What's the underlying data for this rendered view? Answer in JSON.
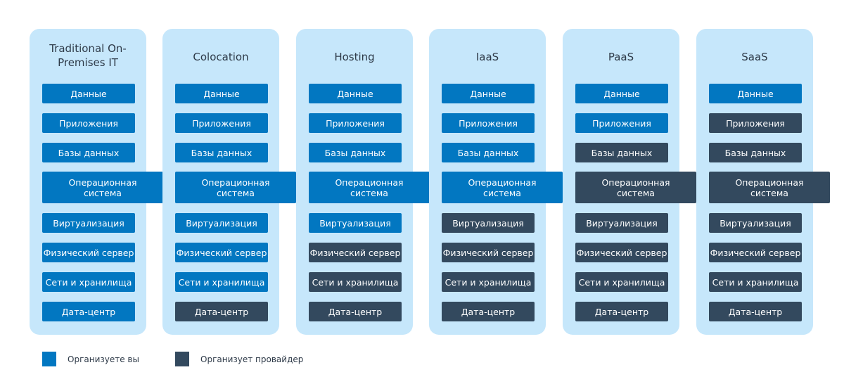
{
  "colors": {
    "you": "#0277c1",
    "provider": "#33495e",
    "panel": "#c6e7fb"
  },
  "layers": [
    "Данные",
    "Приложения",
    "Базы данных",
    "Операционная система",
    "Виртуализация",
    "Физический сервер",
    "Сети и хранилища",
    "Дата-центр"
  ],
  "columns": [
    {
      "title": "Traditional On-Premises IT",
      "owners": [
        "you",
        "you",
        "you",
        "you",
        "you",
        "you",
        "you",
        "you"
      ]
    },
    {
      "title": "Colocation",
      "owners": [
        "you",
        "you",
        "you",
        "you",
        "you",
        "you",
        "you",
        "provider"
      ]
    },
    {
      "title": "Hosting",
      "owners": [
        "you",
        "you",
        "you",
        "you",
        "you",
        "provider",
        "provider",
        "provider"
      ]
    },
    {
      "title": "IaaS",
      "owners": [
        "you",
        "you",
        "you",
        "you",
        "provider",
        "provider",
        "provider",
        "provider"
      ]
    },
    {
      "title": "PaaS",
      "owners": [
        "you",
        "you",
        "provider",
        "provider",
        "provider",
        "provider",
        "provider",
        "provider"
      ]
    },
    {
      "title": "SaaS",
      "owners": [
        "you",
        "provider",
        "provider",
        "provider",
        "provider",
        "provider",
        "provider",
        "provider"
      ]
    }
  ],
  "legend": {
    "you": "Организуете вы",
    "provider": "Организует провайдер"
  }
}
